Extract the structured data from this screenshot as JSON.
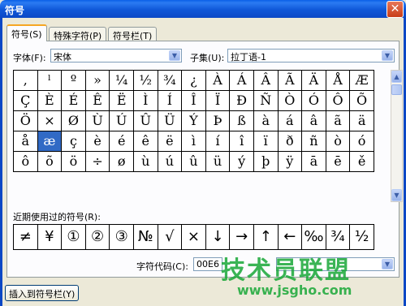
{
  "window": {
    "title": "符号",
    "close_glyph": "✕"
  },
  "tabs": [
    {
      "label": "符号(S)"
    },
    {
      "label": "特殊字符(P)"
    },
    {
      "label": "符号栏(T)"
    }
  ],
  "font": {
    "label": "字体(F):",
    "value": "宋体"
  },
  "subset": {
    "label": "子集(U):",
    "value": "拉丁语-1"
  },
  "symbols": [
    ",",
    "ˡ",
    "º",
    "»",
    "¼",
    "½",
    "¾",
    "¿",
    "À",
    "Á",
    "Â",
    "Ã",
    "Ä",
    "Å",
    "Æ",
    "Ç",
    "È",
    "É",
    "Ê",
    "Ë",
    "Ì",
    "Í",
    "Î",
    "Ï",
    "Ð",
    "Ñ",
    "Ò",
    "Ó",
    "Ô",
    "Õ",
    "Ö",
    "×",
    "Ø",
    "Ù",
    "Ú",
    "Û",
    "Ü",
    "Ý",
    "Þ",
    "ß",
    "à",
    "á",
    "â",
    "ã",
    "ä",
    "å",
    "æ",
    "ç",
    "è",
    "é",
    "ê",
    "ë",
    "ì",
    "í",
    "î",
    "ï",
    "ð",
    "ñ",
    "ò",
    "ó",
    "ô",
    "õ",
    "ö",
    "÷",
    "ø",
    "ù",
    "ú",
    "û",
    "ü",
    "ý",
    "þ",
    "ÿ",
    "ā",
    "ē",
    "ě"
  ],
  "selected_symbol": "æ",
  "recent": {
    "label": "近期使用过的符号(R):",
    "items": [
      "≠",
      "¥",
      "①",
      "②",
      "③",
      "№",
      "√",
      "×",
      "↓",
      "→",
      "↑",
      "←",
      "‰",
      "¾",
      "½"
    ]
  },
  "char_code": {
    "label": "字符代码(C):",
    "value": "00E6"
  },
  "insert_to_bar_button": "插入到符号栏(Y)",
  "watermark": {
    "text": "技术员联盟",
    "url": "www.jsgho.com"
  }
}
